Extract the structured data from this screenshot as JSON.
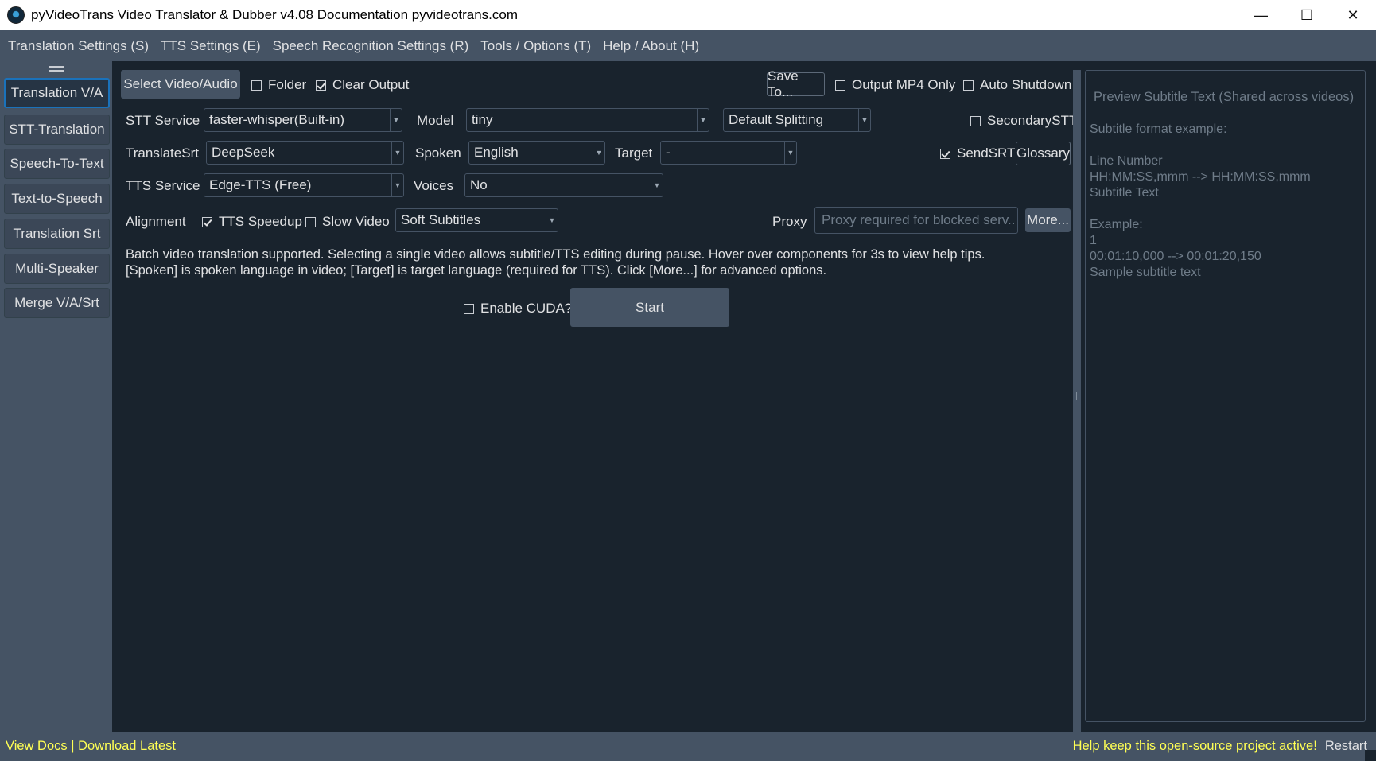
{
  "window": {
    "title": "pyVideoTrans Video Translator & Dubber v4.08 Documentation pyvideotrans.com",
    "controls": [
      "—",
      "☐",
      "✕"
    ]
  },
  "menu": [
    "Translation Settings (S)",
    "TTS Settings (E)",
    "Speech Recognition Settings (R)",
    "Tools / Options (T)",
    "Help / About (H)"
  ],
  "sidebar": {
    "items": [
      "Translation V/A",
      "STT-Translation",
      "Speech-To-Text",
      "Text-to-Speech",
      "Translation Srt",
      "Multi-Speaker",
      "Merge V/A/Srt"
    ],
    "active": "Translation V/A"
  },
  "row1": {
    "select_btn": "Select Video/Audio",
    "folder": "Folder",
    "clear_output": "Clear Output",
    "save_to": "Save To...",
    "output_mp4": "Output MP4 Only",
    "auto_shutdown": "Auto Shutdown"
  },
  "row2": {
    "stt_label": "STT Service",
    "stt_value": "faster-whisper(Built-in)",
    "model_label": "Model",
    "model_value": "tiny",
    "split_value": "Default Splitting",
    "secondary_stt": "SecondarySTT"
  },
  "row3": {
    "translate_label": "TranslateSrt",
    "translate_value": "DeepSeek",
    "spoken_label": "Spoken",
    "spoken_value": "English",
    "target_label": "Target",
    "target_value": "-",
    "send_srt": "SendSRT",
    "glossary": "Glossary"
  },
  "row4": {
    "tts_label": "TTS Service",
    "tts_value": "Edge-TTS (Free)",
    "voices_label": "Voices",
    "voices_value": "No"
  },
  "row5": {
    "alignment": "Alignment",
    "tts_speedup": "TTS Speedup",
    "slow_video": "Slow Video",
    "subtitle_value": "Soft Subtitles",
    "proxy_label": "Proxy",
    "proxy_placeholder": "Proxy required for blocked serv...",
    "more": "More..."
  },
  "info": {
    "line1": "Batch video translation supported. Selecting a single video allows subtitle/TTS editing during pause. Hover over components for 3s to view help tips.",
    "line2": "[Spoken] is spoken language in video; [Target] is target language (required for TTS). Click [More...] for advanced options."
  },
  "actions": {
    "cuda": "Enable CUDA?",
    "start": "Start"
  },
  "preview": {
    "placeholder": "Preview Subtitle Text (Shared across videos)",
    "sample": "Subtitle format example:\n\nLine Number\nHH:MM:SS,mmm --> HH:MM:SS,mmm\nSubtitle Text\n\nExample:\n1\n00:01:10,000 --> 00:01:20,150\nSample subtitle text"
  },
  "status": {
    "docs": "View Docs | Download Latest",
    "support": "Help keep this open-source project active!",
    "restart": "Restart"
  },
  "colors": {
    "background": "#19232d",
    "panel": "#455364",
    "accent": "#1a72bb",
    "link": "#ffff54"
  }
}
